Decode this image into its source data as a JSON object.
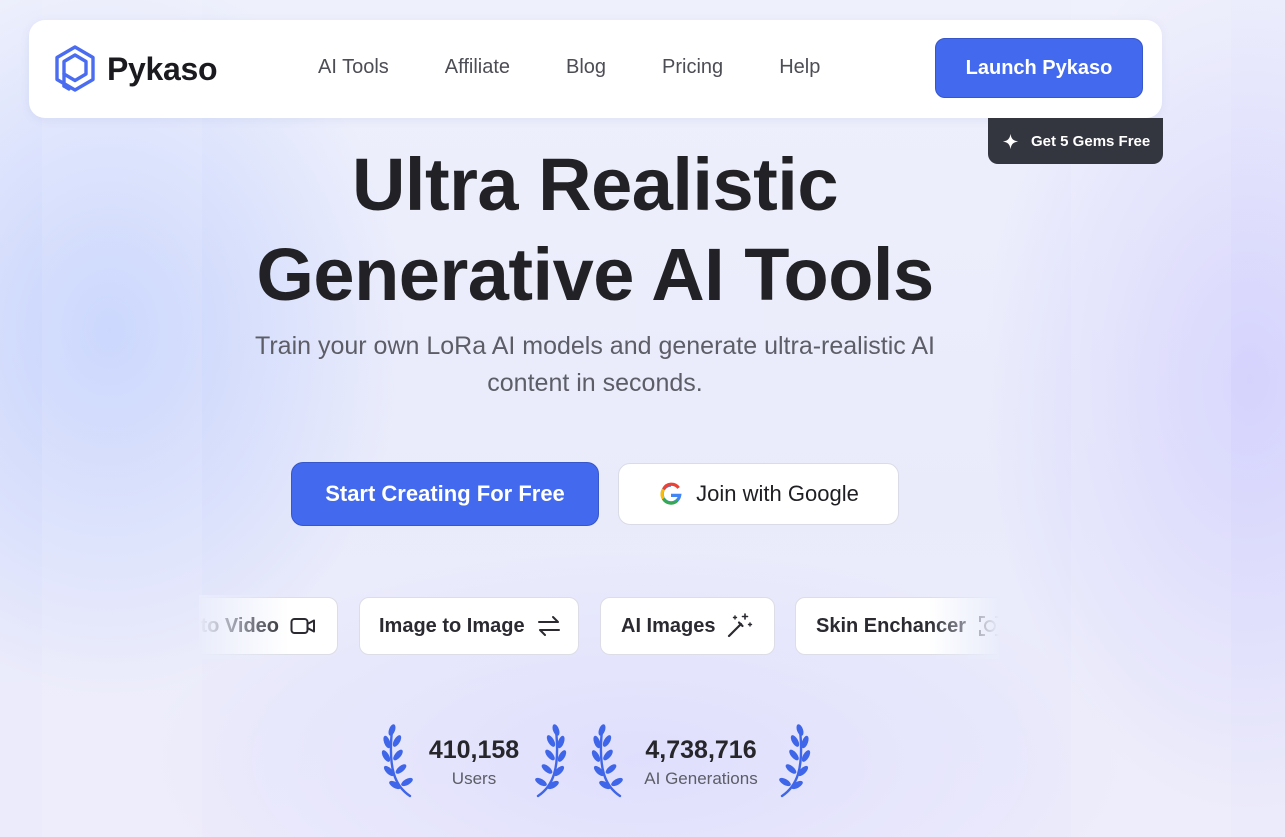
{
  "brand": {
    "name": "Pykaso",
    "accent": "#4269ee"
  },
  "nav": {
    "links": [
      "AI Tools",
      "Affiliate",
      "Blog",
      "Pricing",
      "Help"
    ],
    "launch_label": "Launch Pykaso",
    "gems_label": "Get 5 Gems Free"
  },
  "hero": {
    "title_line1": "Ultra Realistic",
    "title_line2": "Generative AI Tools",
    "subtitle": "Train your own LoRa AI models and generate ultra-realistic AI content in seconds.",
    "primary_cta": "Start Creating For Free",
    "google_cta": "Join with Google"
  },
  "tools": [
    {
      "label": "to Video",
      "icon": "video-camera-icon"
    },
    {
      "label": "Image to Image",
      "icon": "swap-arrows-icon"
    },
    {
      "label": "AI Images",
      "icon": "magic-wand-icon"
    },
    {
      "label": "Skin Enchancer",
      "icon": "face-frame-icon"
    }
  ],
  "stats": [
    {
      "value": "410,158",
      "label": "Users"
    },
    {
      "value": "4,738,716",
      "label": "AI Generations"
    }
  ]
}
